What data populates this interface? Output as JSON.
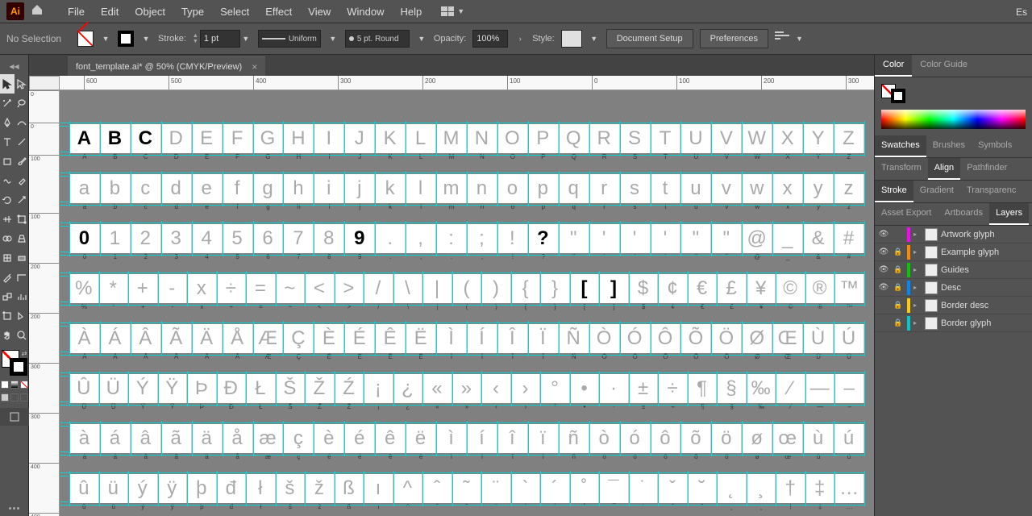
{
  "menubar": {
    "items": [
      "File",
      "Edit",
      "Object",
      "Type",
      "Select",
      "Effect",
      "View",
      "Window",
      "Help"
    ],
    "essentials": "Es"
  },
  "controlbar": {
    "no_selection": "No Selection",
    "stroke_label": "Stroke:",
    "stroke_weight": "1 pt",
    "profile_label": "Uniform",
    "brush_label": "5 pt. Round",
    "opacity_label": "Opacity:",
    "opacity_value": "100%",
    "style_label": "Style:",
    "doc_setup": "Document Setup",
    "preferences": "Preferences"
  },
  "document": {
    "tab_title": "font_template.ai* @ 50% (CMYK/Preview)"
  },
  "ruler": {
    "h": [
      "600",
      "500",
      "400",
      "300",
      "200",
      "100",
      "0",
      "100",
      "200",
      "300"
    ],
    "v": [
      "0",
      "100",
      "200",
      "300",
      "400"
    ]
  },
  "glyph_rows": [
    {
      "chars": [
        "A",
        "B",
        "C",
        "D",
        "E",
        "F",
        "G",
        "H",
        "I",
        "J",
        "K",
        "L",
        "M",
        "N",
        "O",
        "P",
        "Q",
        "R",
        "S",
        "T",
        "U",
        "V",
        "W",
        "X",
        "Y",
        "Z"
      ],
      "drawn": [
        0,
        1,
        2
      ],
      "labels": [
        "A",
        "B",
        "C",
        "D",
        "E",
        "F",
        "G",
        "H",
        "I",
        "J",
        "K",
        "L",
        "M",
        "N",
        "O",
        "P",
        "Q",
        "R",
        "S",
        "T",
        "U",
        "V",
        "W",
        "X",
        "Y",
        "Z"
      ]
    },
    {
      "chars": [
        "a",
        "b",
        "c",
        "d",
        "e",
        "f",
        "g",
        "h",
        "i",
        "j",
        "k",
        "l",
        "m",
        "n",
        "o",
        "p",
        "q",
        "r",
        "s",
        "t",
        "u",
        "v",
        "w",
        "x",
        "y",
        "z"
      ],
      "drawn": [],
      "labels": [
        "a",
        "b",
        "c",
        "d",
        "e",
        "f",
        "g",
        "h",
        "i",
        "j",
        "k",
        "l",
        "m",
        "n",
        "o",
        "p",
        "q",
        "r",
        "s",
        "t",
        "u",
        "v",
        "w",
        "x",
        "y",
        "z"
      ]
    },
    {
      "chars": [
        "0",
        "1",
        "2",
        "3",
        "4",
        "5",
        "6",
        "7",
        "8",
        "9",
        ".",
        ",",
        ":",
        ";",
        "!",
        "?",
        "\"",
        "'",
        "'",
        "'",
        "\"",
        "\"",
        "@",
        "_",
        "&",
        "#"
      ],
      "drawn": [
        0,
        9,
        15
      ],
      "labels": [
        "0",
        "1",
        "2",
        "3",
        "4",
        "5",
        "6",
        "7",
        "8",
        "9",
        ".",
        ",",
        ":",
        ";",
        "!",
        "?",
        "\"",
        "'",
        "'",
        "'",
        "\"",
        "\"",
        "@",
        "_",
        "&",
        "#"
      ]
    },
    {
      "chars": [
        "%",
        "*",
        "+",
        "-",
        "x",
        "÷",
        "=",
        "~",
        "<",
        ">",
        "/",
        "\\",
        "|",
        "(",
        ")",
        "{",
        "}",
        "[",
        "]",
        "$",
        "¢",
        "€",
        "£",
        "¥",
        "©",
        "®",
        "™"
      ],
      "drawn": [
        17,
        18
      ],
      "labels": [
        "%",
        "*",
        "+",
        "-",
        "x",
        "÷",
        "=",
        "~",
        "<",
        ">",
        "/",
        "\\",
        "|",
        "(",
        ")",
        "{",
        "}",
        "[",
        "]",
        "$",
        "¢",
        "€",
        "£",
        "¥",
        "©",
        "®",
        "™"
      ]
    },
    {
      "chars": [
        "À",
        "Á",
        "Â",
        "Ã",
        "Ä",
        "Å",
        "Æ",
        "Ç",
        "È",
        "É",
        "Ê",
        "Ë",
        "Ì",
        "Í",
        "Î",
        "Ï",
        "Ñ",
        "Ò",
        "Ó",
        "Ô",
        "Õ",
        "Ö",
        "Ø",
        "Œ",
        "Ù",
        "Ú"
      ],
      "drawn": [],
      "labels": [
        "À",
        "Á",
        "Â",
        "Ã",
        "Ä",
        "Å",
        "Æ",
        "Ç",
        "È",
        "É",
        "Ê",
        "Ë",
        "Ì",
        "Í",
        "Î",
        "Ï",
        "Ñ",
        "Ò",
        "Ó",
        "Ô",
        "Õ",
        "Ö",
        "Ø",
        "Œ",
        "Ù",
        "Ú"
      ]
    },
    {
      "chars": [
        "Û",
        "Ü",
        "Ý",
        "Ÿ",
        "Þ",
        "Đ",
        "Ł",
        "Š",
        "Ž",
        "Ź",
        "¡",
        "¿",
        "«",
        "»",
        "‹",
        "›",
        "°",
        "•",
        "·",
        "±",
        "÷",
        "¶",
        "§",
        "‰",
        "⁄",
        "—",
        "–"
      ],
      "drawn": [],
      "labels": [
        "Û",
        "Ü",
        "Ý",
        "Ÿ",
        "Þ",
        "Đ",
        "Ł",
        "Š",
        "Ž",
        "Ź",
        "¡",
        "¿",
        "«",
        "»",
        "‹",
        "›",
        "°",
        "•",
        "·",
        "±",
        "÷",
        "¶",
        "§",
        "‰",
        "⁄",
        "—",
        "–"
      ]
    },
    {
      "chars": [
        "à",
        "á",
        "â",
        "ã",
        "ä",
        "å",
        "æ",
        "ç",
        "è",
        "é",
        "ê",
        "ë",
        "ì",
        "í",
        "î",
        "ï",
        "ñ",
        "ò",
        "ó",
        "ô",
        "õ",
        "ö",
        "ø",
        "œ",
        "ù",
        "ú"
      ],
      "drawn": [],
      "labels": [
        "à",
        "á",
        "â",
        "ã",
        "ä",
        "å",
        "æ",
        "ç",
        "è",
        "é",
        "ê",
        "ë",
        "ì",
        "í",
        "î",
        "ï",
        "ñ",
        "ò",
        "ó",
        "ô",
        "õ",
        "ö",
        "ø",
        "œ",
        "ù",
        "ú"
      ]
    },
    {
      "chars": [
        "û",
        "ü",
        "ý",
        "ÿ",
        "þ",
        "đ",
        "ł",
        "š",
        "ž",
        "ß",
        "ı",
        "^",
        "ˆ",
        "˜",
        "¨",
        "`",
        "´",
        "˚",
        "¯",
        "˙",
        "ˇ",
        "˘",
        "˛",
        "¸",
        "†",
        "‡",
        "…"
      ],
      "drawn": [],
      "labels": [
        "û",
        "ü",
        "ý",
        "ÿ",
        "þ",
        "đ",
        "ł",
        "š",
        "ž",
        "ß",
        "ı",
        "^",
        "ˆ",
        "˜",
        "¨",
        "`",
        "´",
        "˚",
        "¯",
        "˙",
        "ˇ",
        "˘",
        "˛",
        "¸",
        "†",
        "‡",
        "…"
      ]
    }
  ],
  "panels": {
    "color_tab": "Color",
    "colorguide_tab": "Color Guide",
    "swatches": "Swatches",
    "brushes": "Brushes",
    "symbols": "Symbols",
    "transform": "Transform",
    "align": "Align",
    "pathfinder": "Pathfinder",
    "stroke": "Stroke",
    "gradient": "Gradient",
    "transparency": "Transparenc",
    "asset_export": "Asset Export",
    "artboards": "Artboards",
    "layers": "Layers"
  },
  "layers": [
    {
      "name": "Artwork glyph",
      "color": "#ff00ff",
      "visible": true,
      "locked": false
    },
    {
      "name": "Example glyph",
      "color": "#ff8800",
      "visible": true,
      "locked": true
    },
    {
      "name": "Guides",
      "color": "#00cc00",
      "visible": true,
      "locked": true
    },
    {
      "name": "Desc",
      "color": "#0088ff",
      "visible": true,
      "locked": true
    },
    {
      "name": "Border desc",
      "color": "#ffcc00",
      "visible": false,
      "locked": true
    },
    {
      "name": "Border glyph",
      "color": "#00cccc",
      "visible": false,
      "locked": true
    }
  ]
}
